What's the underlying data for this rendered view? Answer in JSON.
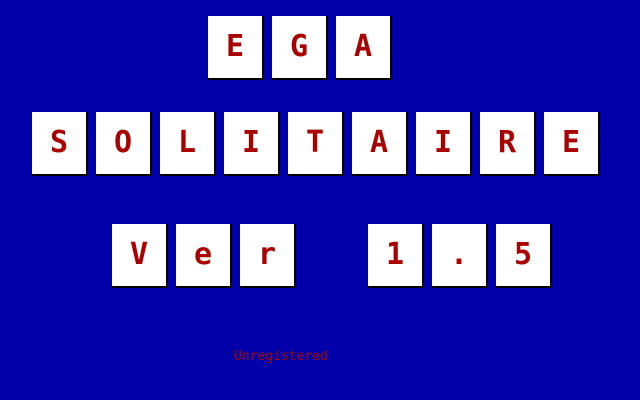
{
  "title_row_1": [
    "E",
    "G",
    "A"
  ],
  "title_row_2": [
    "S",
    "O",
    "L",
    "I",
    "T",
    "A",
    "I",
    "R",
    "E"
  ],
  "version_row": [
    "V",
    "e",
    "r",
    "1",
    ".",
    "5"
  ],
  "status_text": "Unregistered",
  "colors": {
    "background": "#0000aa",
    "tile": "#ffffff",
    "letter": "#aa0000",
    "tile_shadow": "#000000"
  }
}
